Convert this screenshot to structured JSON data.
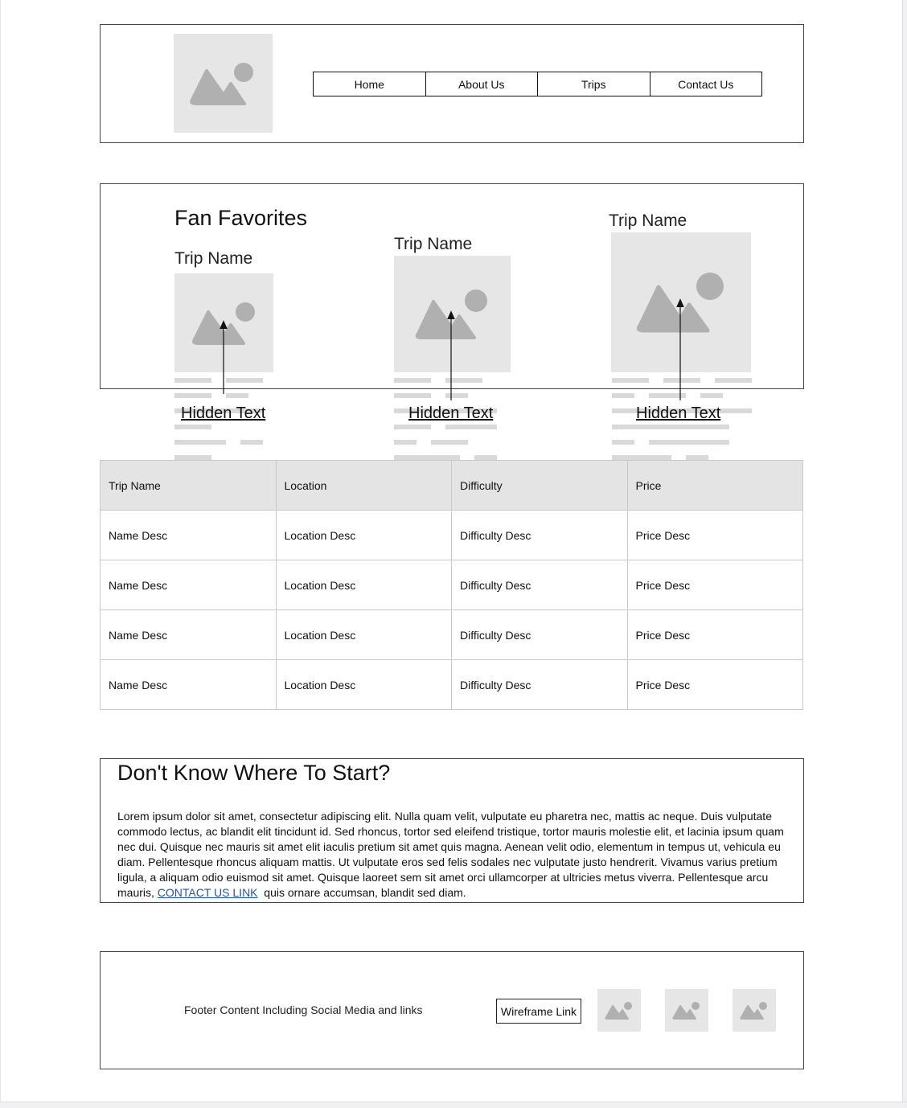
{
  "nav": {
    "items": [
      "Home",
      "About Us",
      "Trips",
      "Contact Us"
    ]
  },
  "favorites": {
    "title": "Fan Favorites",
    "trips": [
      {
        "name": "Trip Name",
        "link": "Hidden Text"
      },
      {
        "name": "Trip Name",
        "link": "Hidden Text"
      },
      {
        "name": "Trip Name",
        "link": "Hidden Text"
      }
    ]
  },
  "table": {
    "headers": [
      "Trip Name",
      "Location",
      "Difficulty",
      "Price"
    ],
    "rows": [
      [
        "Name Desc",
        "Location Desc",
        "Difficulty Desc",
        "Price Desc"
      ],
      [
        "Name Desc",
        "Location Desc",
        "Difficulty Desc",
        "Price Desc"
      ],
      [
        "Name Desc",
        "Location Desc",
        "Difficulty Desc",
        "Price Desc"
      ],
      [
        "Name Desc",
        "Location Desc",
        "Difficulty Desc",
        "Price Desc"
      ]
    ]
  },
  "start": {
    "title": "Don't Know Where To Start?",
    "body_before": "Lorem ipsum dolor sit amet, consectetur adipiscing elit. Nulla quam velit, vulputate eu pharetra nec, mattis ac neque. Duis vulputate commodo lectus, ac blandit elit tincidunt id. Sed rhoncus, tortor sed eleifend tristique, tortor mauris molestie elit, et lacinia ipsum quam nec dui. Quisque nec mauris sit amet elit iaculis pretium sit amet quis magna. Aenean velit odio, elementum in tempus ut, vehicula eu diam. Pellentesque rhoncus aliquam mattis. Ut vulputate eros sed felis sodales nec vulputate justo hendrerit. Vivamus varius pretium ligula, a aliquam odio euismod sit amet. Quisque laoreet sem sit amet orci ullamcorper at ultricies metus viverra. Pellentesque arcu mauris, ",
    "link": "CONTACT US LINK",
    "body_after": "  quis ornare accumsan, blandit sed diam."
  },
  "footer": {
    "text": "Footer Content Including Social Media and links",
    "link": "Wireframe Link",
    "social_icons": [
      "image-placeholder-icon",
      "image-placeholder-icon",
      "image-placeholder-icon"
    ]
  }
}
